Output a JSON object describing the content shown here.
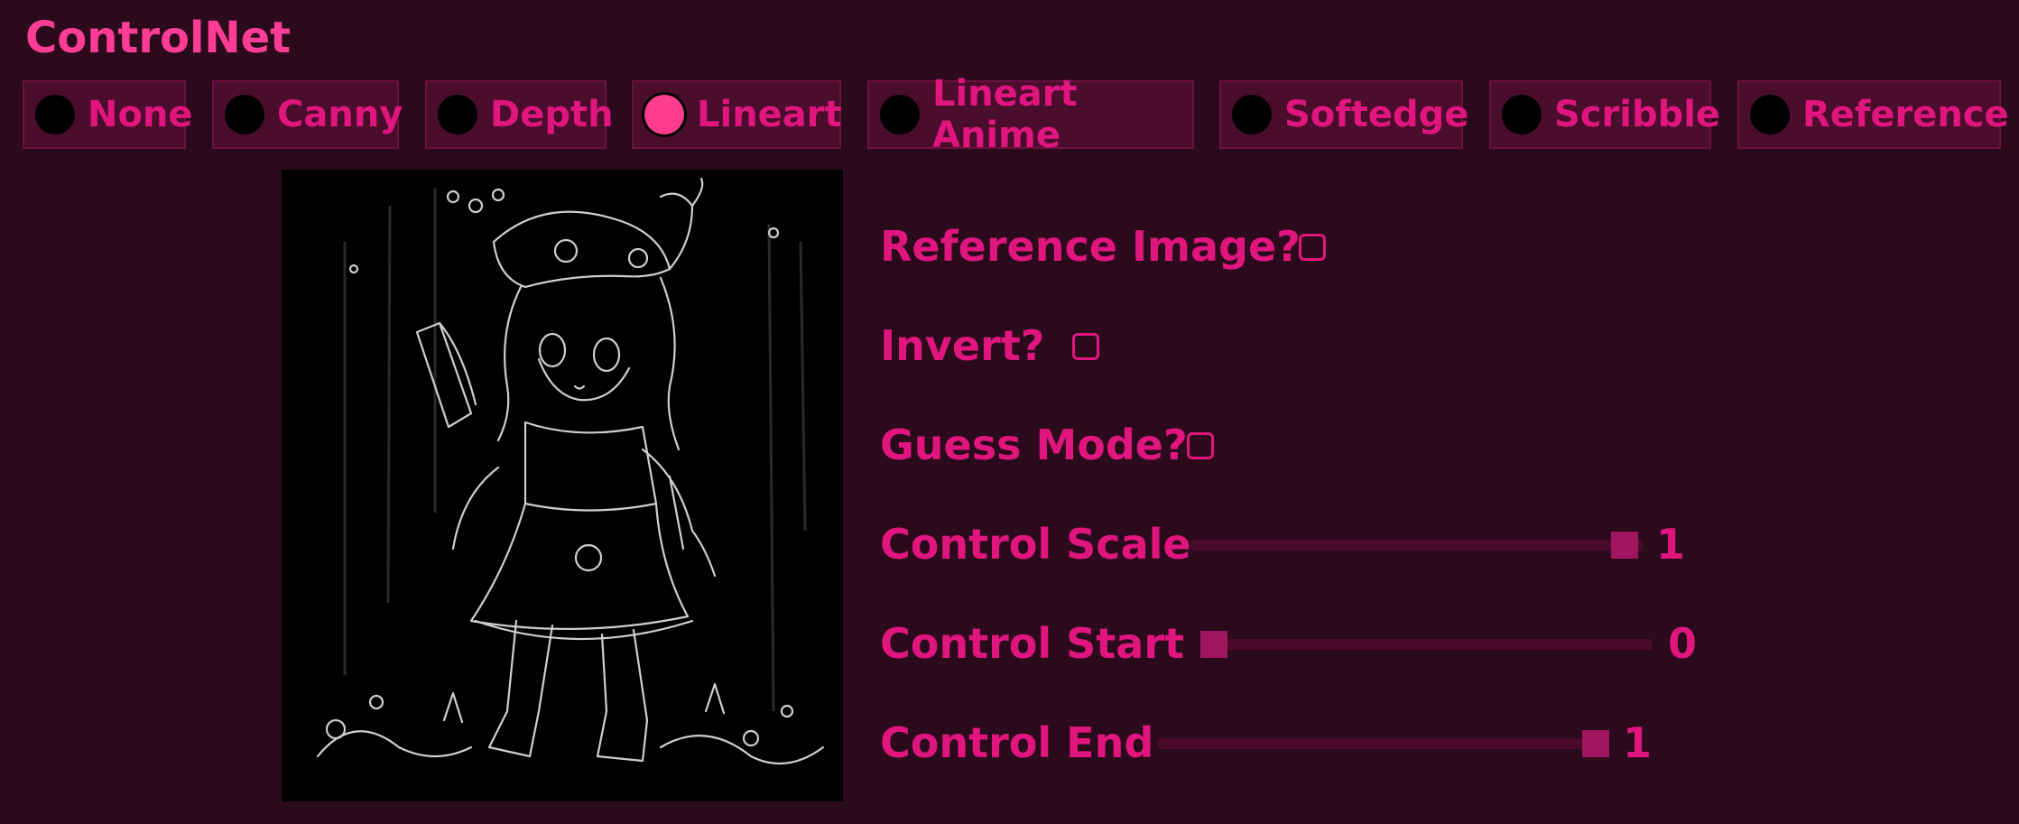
{
  "panel": {
    "title": "ControlNet"
  },
  "modes": [
    {
      "label": "None",
      "selected": false
    },
    {
      "label": "Canny",
      "selected": false
    },
    {
      "label": "Depth",
      "selected": false
    },
    {
      "label": "Lineart",
      "selected": true
    },
    {
      "label": "Lineart Anime",
      "selected": false
    },
    {
      "label": "Softedge",
      "selected": false
    },
    {
      "label": "Scribble",
      "selected": false
    },
    {
      "label": "Reference",
      "selected": false
    }
  ],
  "options": {
    "reference_image": {
      "label": "Reference Image?",
      "checked": false
    },
    "invert": {
      "label": "Invert?",
      "checked": false
    },
    "guess_mode": {
      "label": "Guess Mode?",
      "checked": false
    }
  },
  "sliders": {
    "control_scale": {
      "label": "Control Scale",
      "value": "1",
      "fraction": 1.0
    },
    "control_start": {
      "label": "Control Start",
      "value": "0",
      "fraction": 0.0
    },
    "control_end": {
      "label": "Control End",
      "value": "1",
      "fraction": 1.0
    }
  },
  "colors": {
    "background": "#2a0a1b",
    "accent": "#e0157e",
    "title": "#ff3d97",
    "tab_bg": "#4a0d2c",
    "selected_radio": "#ff3d8c"
  }
}
